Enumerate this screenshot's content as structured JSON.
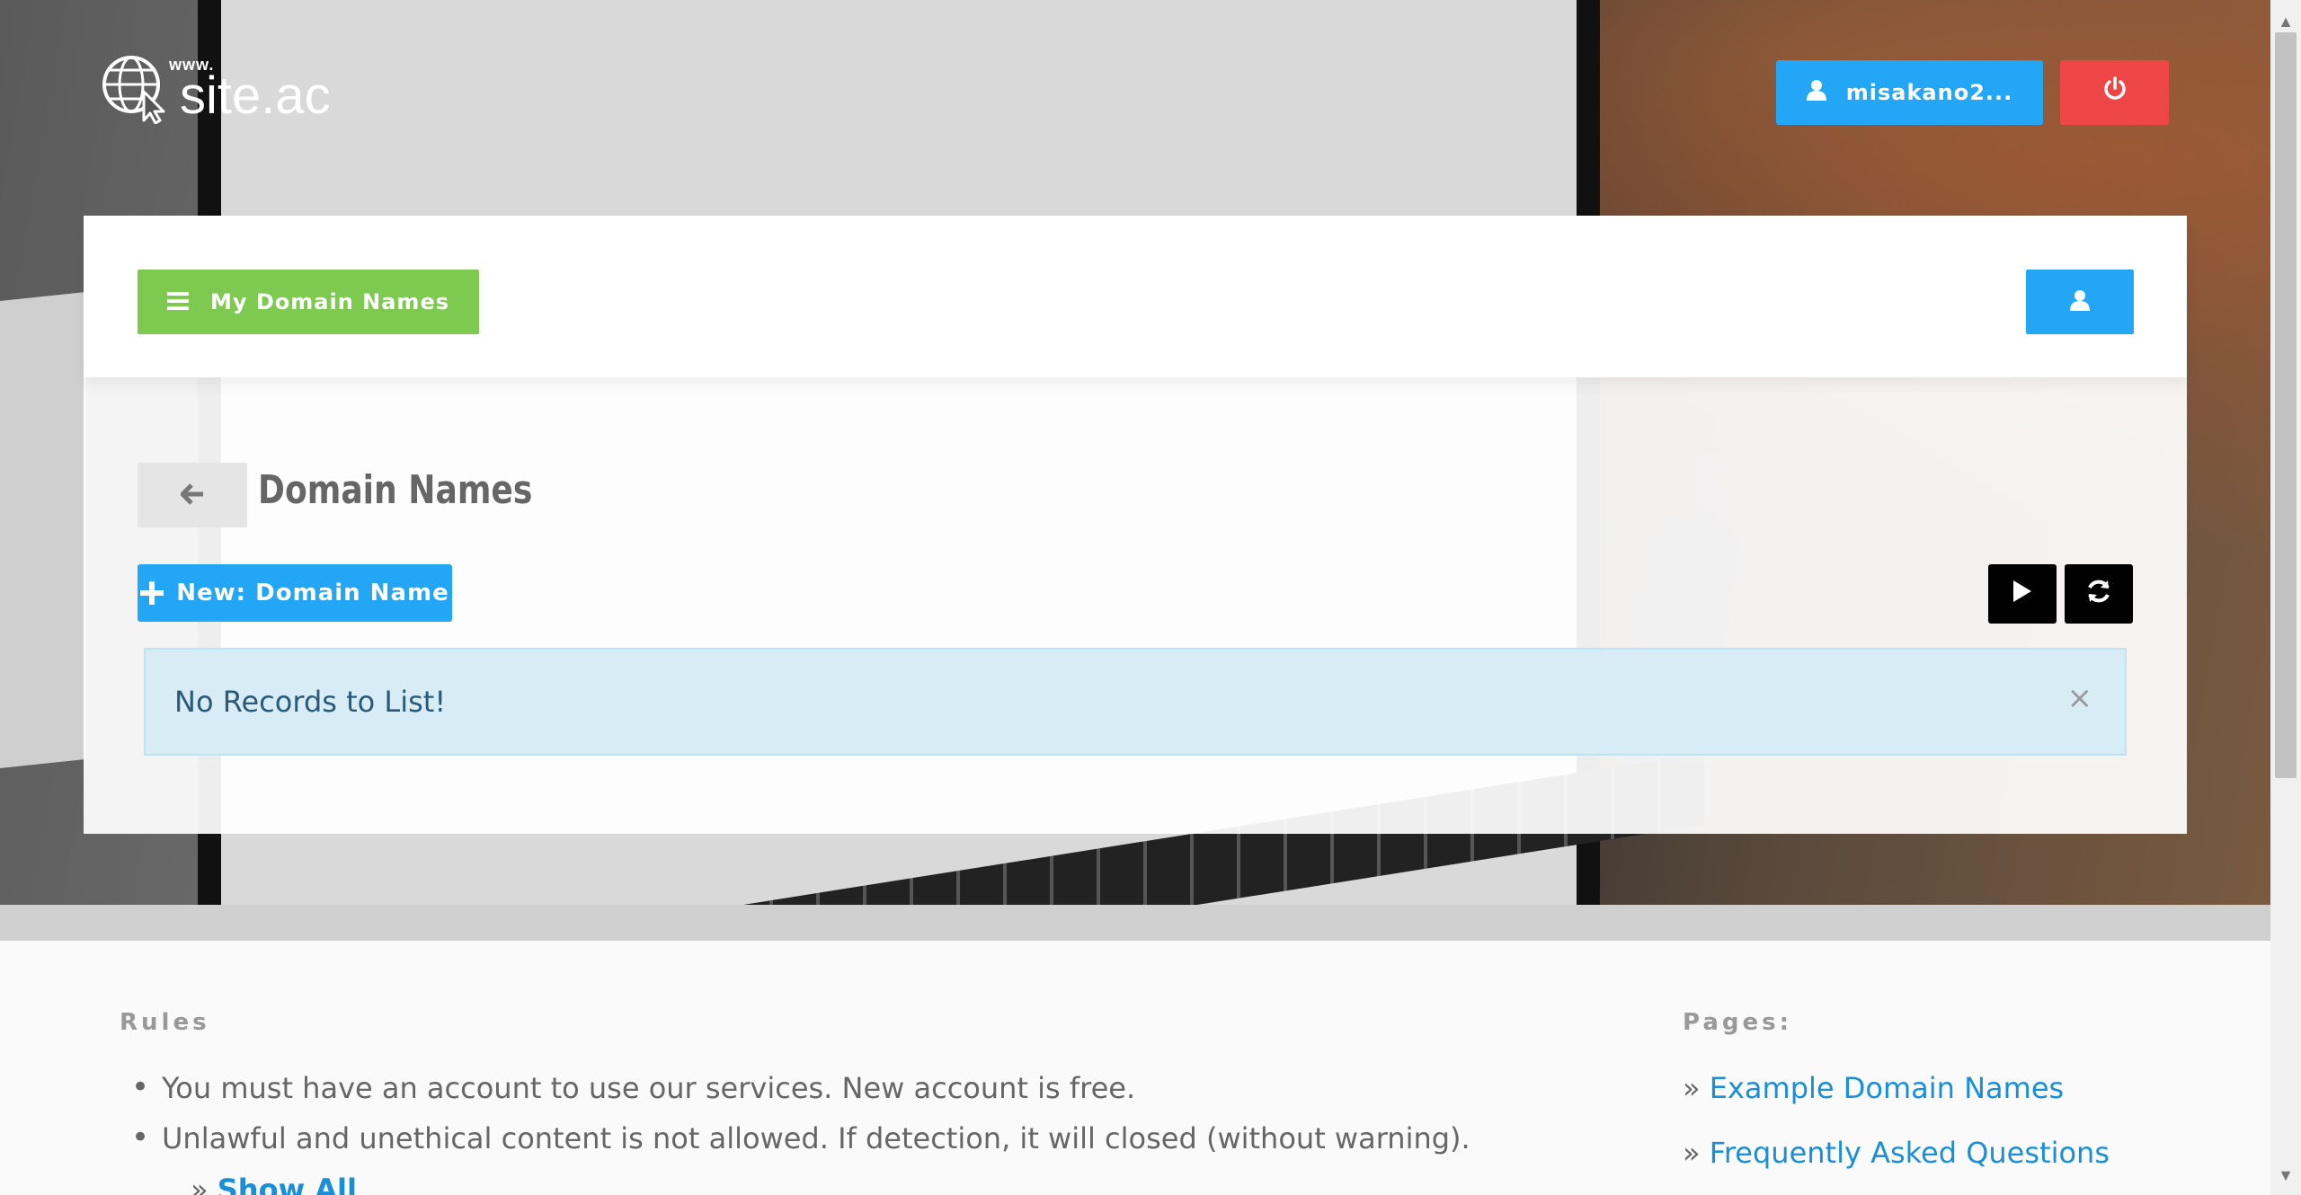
{
  "header": {
    "logo_www": "www.",
    "logo_name": "site.ac",
    "user_label": "misakano2...",
    "logout_icon": "power-icon"
  },
  "toolbar": {
    "my_domains_label": "My Domain Names",
    "menu_icon": "hamburger-icon",
    "profile_icon": "user-icon"
  },
  "main": {
    "back_icon": "arrow-left-icon",
    "title": "Domain Names",
    "new_button_label": "New: Domain Name",
    "play_icon": "play-icon",
    "refresh_icon": "refresh-icon",
    "alert_text": "No Records to List!",
    "alert_close": "×"
  },
  "footer": {
    "rules_title": "Rules",
    "rules": [
      "You must have an account to use our services. New account is free.",
      "Unlawful and unethical content is not allowed. If detection, it will closed (without warning)."
    ],
    "show_all_prefix": "» ",
    "show_all_label": "Show All",
    "pages_title": "Pages:",
    "pages_prefix": "» ",
    "pages": [
      "Example Domain Names",
      "Frequently Asked Questions"
    ]
  },
  "colors": {
    "accent_blue": "#22a6f5",
    "danger_red": "#ee4646",
    "success_green": "#7ec950",
    "alert_bg": "#d8ecf6",
    "link_blue": "#1a8fd9"
  }
}
